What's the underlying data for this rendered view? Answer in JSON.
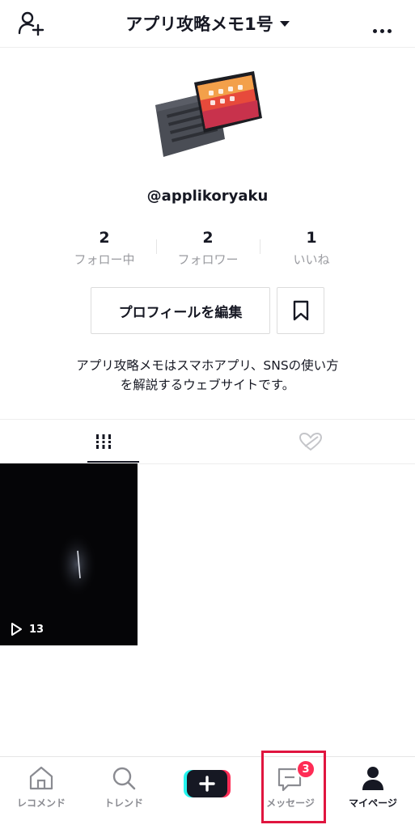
{
  "header": {
    "title": "アプリ攻略メモ1号"
  },
  "profile": {
    "username": "@applikoryaku",
    "stats": [
      {
        "value": "2",
        "label": "フォロー中"
      },
      {
        "value": "2",
        "label": "フォロワー"
      },
      {
        "value": "1",
        "label": "いいね"
      }
    ],
    "edit_label": "プロフィールを編集",
    "bio_line1": "アプリ攻略メモはスマホアプリ、SNSの使い方",
    "bio_line2": "を解説するウェブサイトです。"
  },
  "videos": [
    {
      "views": "13"
    }
  ],
  "nav": {
    "items": [
      {
        "label": "レコメンド",
        "icon": "home-icon"
      },
      {
        "label": "トレンド",
        "icon": "search-icon"
      },
      {
        "label": "",
        "icon": "plus-icon"
      },
      {
        "label": "メッセージ",
        "icon": "message-icon"
      },
      {
        "label": "マイページ",
        "icon": "profile-icon"
      }
    ],
    "message_badge": "3"
  },
  "colors": {
    "accent": "#fe2c55",
    "highlight": "#e0153f",
    "cyan": "#25f4ee"
  }
}
